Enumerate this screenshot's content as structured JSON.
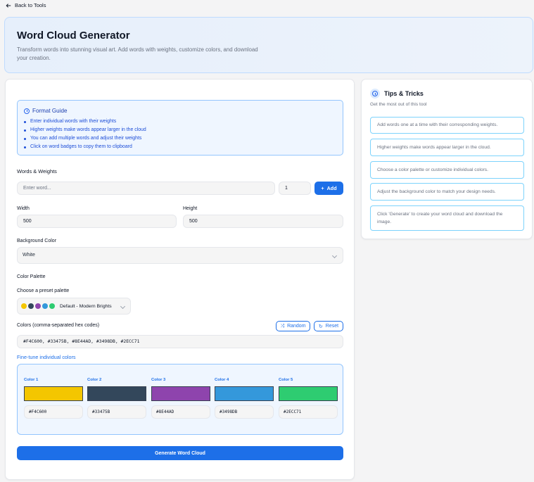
{
  "nav": {
    "back_label": "Back to Tools"
  },
  "header": {
    "title": "Word Cloud Generator",
    "subtitle": "Transform words into stunning visual art. Add words with weights, customize colors, and download your creation."
  },
  "format_guide": {
    "title": "Format Guide",
    "items": [
      "Enter individual words with their weights",
      "Higher weights make words appear larger in the cloud",
      "You can add multiple words and adjust their weights",
      "Click on word badges to copy them to clipboard"
    ]
  },
  "words": {
    "label": "Words & Weights",
    "word_placeholder": "Enter word...",
    "weight_value": "1",
    "add_label": "Add"
  },
  "size": {
    "width_label": "Width",
    "width_value": "500",
    "height_label": "Height",
    "height_value": "500"
  },
  "background": {
    "label": "Background Color",
    "value": "White"
  },
  "palette": {
    "section_label": "Color Palette",
    "preset_label": "Choose a preset palette",
    "preset_value": "Default - Modern Brights",
    "preset_dots": [
      "#F4C600",
      "#33475B",
      "#8E44AD",
      "#3498DB",
      "#2ECC71"
    ],
    "colors_label": "Colors (comma-separated hex codes)",
    "random_label": "Random",
    "reset_label": "Reset",
    "colors_value": "#F4C600, #33475B, #8E44AD, #3498DB, #2ECC71",
    "fine_tune_label": "Fine-tune individual colors",
    "swatches": [
      {
        "name": "Color 1",
        "hex": "#F4C600"
      },
      {
        "name": "Color 2",
        "hex": "#33475B"
      },
      {
        "name": "Color 3",
        "hex": "#8E44AD"
      },
      {
        "name": "Color 4",
        "hex": "#3498DB"
      },
      {
        "name": "Color 5",
        "hex": "#2ECC71"
      }
    ]
  },
  "generate_label": "Generate Word Cloud",
  "tips": {
    "title": "Tips & Tricks",
    "subtitle": "Get the most out of this tool",
    "items": [
      "Add words one at a time with their corresponding weights.",
      "Higher weights make words appear larger in the cloud.",
      "Choose a color palette or customize individual colors.",
      "Adjust the background color to match your design needs.",
      "Click 'Generate' to create your word cloud and download the image."
    ]
  },
  "colors": {
    "accent": "#1d6fe8",
    "guide_bg": "#eff6ff",
    "guide_border": "#93c5fd"
  }
}
